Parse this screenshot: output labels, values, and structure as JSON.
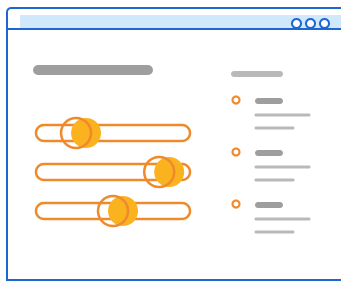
{
  "window": {
    "accent_color": "#1e66d0",
    "titlebar_color": "#cfe8fb",
    "controls": [
      "window-control-1",
      "window-control-2",
      "window-control-3"
    ]
  },
  "sliders": [
    {
      "name": "slider-1",
      "value": 0.26
    },
    {
      "name": "slider-2",
      "value": 0.8
    },
    {
      "name": "slider-3",
      "value": 0.5
    }
  ],
  "colors": {
    "slider_track": "#ef8a2c",
    "slider_fill": "#fbb21f",
    "placeholder_line": "#9e9e9e",
    "placeholder_line_light": "#b9b9b9",
    "bullet": "#ef8a2c"
  },
  "list_items": [
    {
      "name": "list-item-1"
    },
    {
      "name": "list-item-2"
    },
    {
      "name": "list-item-3"
    }
  ]
}
